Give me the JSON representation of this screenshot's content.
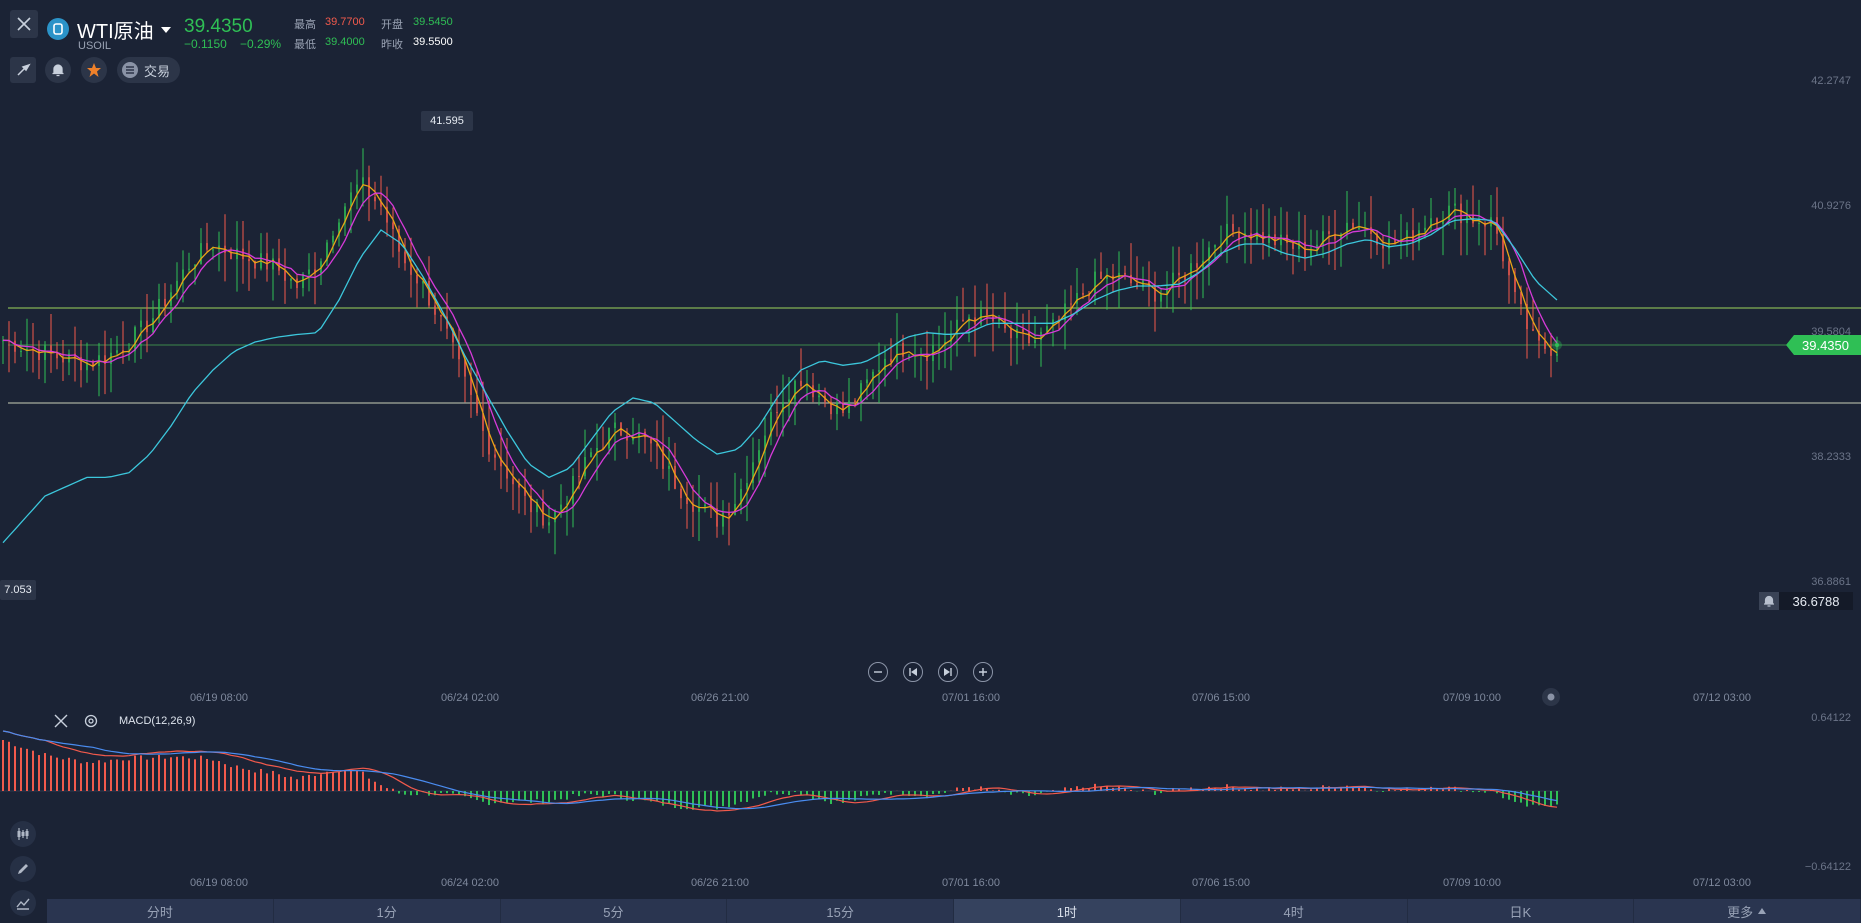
{
  "header": {
    "title": "WTI原油",
    "symbol": "USOIL",
    "price": "39.4350",
    "change": "−0.1150",
    "change_pct": "−0.29%",
    "high_label": "最高",
    "high": "39.7700",
    "low_label": "最低",
    "low": "39.4000",
    "open_label": "开盘",
    "open": "39.5450",
    "prev_close_label": "昨收",
    "prev_close": "39.5500",
    "trade_label": "交易"
  },
  "chart": {
    "y_ticks": [
      "42.2747",
      "40.9276",
      "39.5804",
      "38.2333",
      "36.8861"
    ],
    "x_ticks": [
      "06/19 08:00",
      "06/24 02:00",
      "06/26 21:00",
      "07/01 16:00",
      "07/06 15:00",
      "07/09 10:00",
      "07/12 03:00"
    ],
    "high_marker": "41.595",
    "low_marker": "7.053",
    "current_price_tag": "39.4350",
    "alert_price": "36.6788",
    "colors": {
      "up": "#2fbf55",
      "down": "#f25a4c",
      "ma_fast": "#e8a317",
      "ma_mid": "#d63ad9",
      "ma_slow": "#3cc7dc",
      "price_tag": "#2fbf55"
    }
  },
  "macd": {
    "label": "MACD(12,26,9)",
    "y_top": "0.64122",
    "y_bottom": "−0.64122"
  },
  "timeframes": [
    "分时",
    "1分",
    "5分",
    "15分",
    "1时",
    "4时",
    "日K",
    "更多"
  ],
  "active_timeframe": "1时",
  "chart_data": {
    "type": "line",
    "title": "",
    "ylim": [
      36.8861,
      42.2747
    ],
    "x_ticks": [
      "06/19 08:00",
      "06/24 02:00",
      "06/26 21:00",
      "07/01 16:00",
      "07/06 15:00",
      "07/09 10:00",
      "07/12 03:00"
    ],
    "price": [
      39.52,
      39.45,
      39.38,
      39.32,
      39.28,
      39.35,
      39.5,
      39.72,
      40.05,
      40.38,
      40.55,
      40.45,
      40.38,
      40.3,
      40.1,
      40.35,
      40.88,
      41.2,
      40.95,
      40.4,
      40.1,
      39.65,
      39.05,
      38.45,
      38.1,
      37.75,
      37.6,
      37.9,
      38.3,
      38.55,
      38.55,
      38.35,
      38.0,
      37.75,
      37.6,
      37.85,
      38.4,
      38.9,
      39.12,
      38.9,
      38.75,
      39.0,
      39.35,
      39.45,
      39.4,
      39.55,
      39.78,
      39.75,
      39.55,
      39.5,
      39.65,
      39.92,
      40.15,
      40.2,
      40.1,
      40.02,
      40.18,
      40.4,
      40.65,
      40.7,
      40.62,
      40.55,
      40.48,
      40.62,
      40.78,
      40.72,
      40.55,
      40.62,
      40.85,
      40.92,
      40.82,
      40.78,
      39.95,
      39.45,
      39.44
    ],
    "ma_slow": [
      37.35,
      37.6,
      37.85,
      37.95,
      38.05,
      38.05,
      38.1,
      38.3,
      38.6,
      38.95,
      39.2,
      39.4,
      39.5,
      39.55,
      39.58,
      39.6,
      39.95,
      40.4,
      40.7,
      40.55,
      40.2,
      39.8,
      39.35,
      38.95,
      38.55,
      38.2,
      38.05,
      38.15,
      38.45,
      38.75,
      38.9,
      38.85,
      38.65,
      38.45,
      38.3,
      38.35,
      38.6,
      38.95,
      39.2,
      39.3,
      39.25,
      39.28,
      39.4,
      39.55,
      39.6,
      39.58,
      39.6,
      39.7,
      39.7,
      39.7,
      39.7,
      39.8,
      39.95,
      40.05,
      40.1,
      40.1,
      40.12,
      40.25,
      40.45,
      40.55,
      40.55,
      40.45,
      40.4,
      40.45,
      40.55,
      40.6,
      40.52,
      40.55,
      40.65,
      40.8,
      40.82,
      40.8,
      40.5,
      40.15,
      39.95
    ]
  }
}
